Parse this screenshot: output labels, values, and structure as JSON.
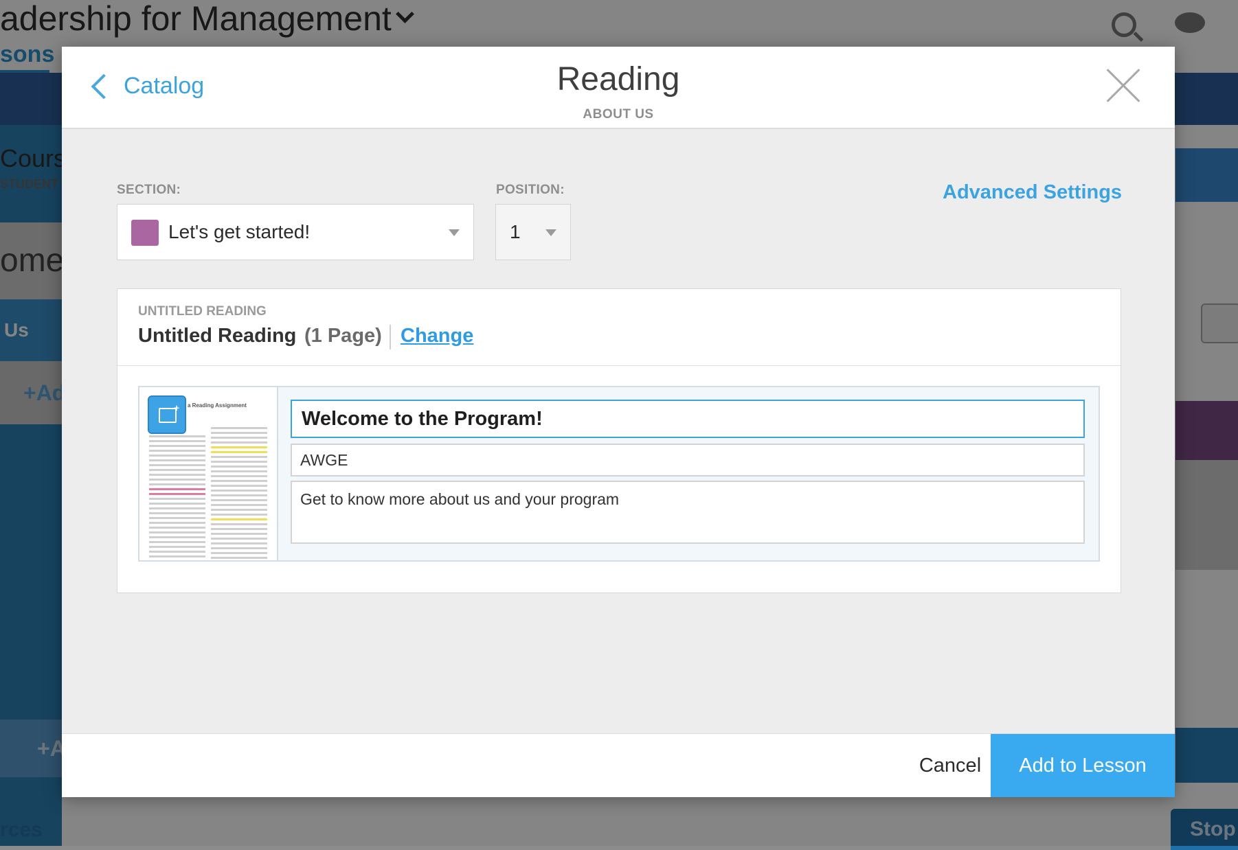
{
  "background": {
    "course_title": "adership for Management",
    "tab_label": "sons",
    "course_label": "Course",
    "student_label": "STUDENT",
    "welcome_text": "ome!",
    "us_text": "Us",
    "add_text_1": "+Ad",
    "add_text_2": "+A",
    "resources_text": "rces",
    "stop_text": "Stop"
  },
  "modal": {
    "back_label": "Catalog",
    "title": "Reading",
    "subtitle": "ABOUT US",
    "section_label": "SECTION:",
    "section_value": "Let's get started!",
    "section_color": "#a966a0",
    "position_label": "POSITION:",
    "position_value": "1",
    "advanced_settings": "Advanced Settings",
    "reading": {
      "header_label": "UNTITLED READING",
      "name": "Untitled Reading",
      "pages": "(1 Page)",
      "change_label": "Change",
      "thumbnail_title": "a Reading Assignment",
      "item_title": "Welcome to the Program!",
      "item_author": "AWGE",
      "item_description": "Get to know more about us and your program"
    },
    "cancel_label": "Cancel",
    "add_label": "Add to Lesson"
  },
  "colors": {
    "accent": "#3ba3df",
    "primary_button": "#3aaaf0"
  }
}
